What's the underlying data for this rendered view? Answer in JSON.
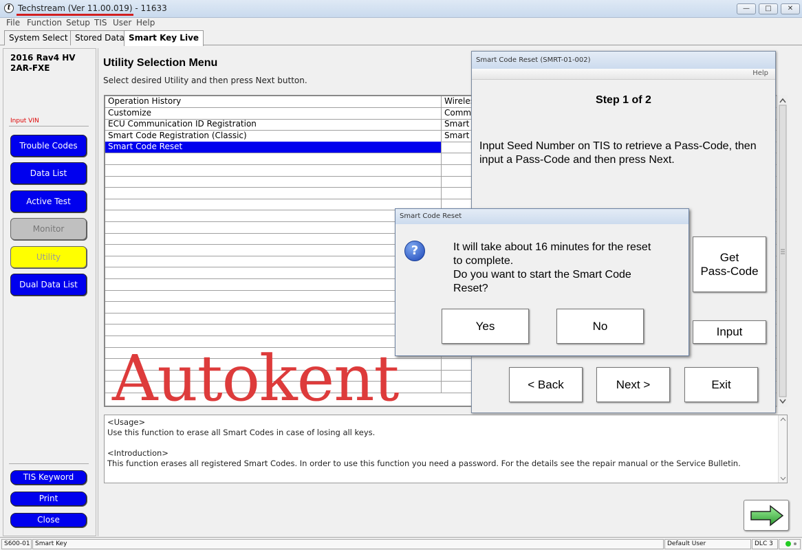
{
  "app": {
    "title": "Techstream (Ver 11.00.019) - 11633",
    "window_controls": {
      "minimize": "—",
      "maximize": "□",
      "close": "✕"
    }
  },
  "menu": [
    "File",
    "Function",
    "Setup",
    "TIS",
    "User",
    "Help"
  ],
  "tabs": [
    "System Select",
    "Stored Data",
    "Smart Key Live"
  ],
  "sidebar": {
    "vehicle": "2016 Rav4 HV\n2AR-FXE",
    "input_vin": "Input VIN",
    "buttons": [
      "Trouble Codes",
      "Data List",
      "Active Test",
      "Monitor",
      "Utility",
      "Dual Data List"
    ],
    "bottom_buttons": [
      "TIS Keyword",
      "Print",
      "Close"
    ]
  },
  "main": {
    "title": "Utility Selection Menu",
    "subtitle": "Select desired Utility and then press Next button.",
    "rows": [
      {
        "name": "Operation History",
        "desc": "Wireles"
      },
      {
        "name": "Customize",
        "desc": "Commu"
      },
      {
        "name": "ECU Communication ID Registration",
        "desc": "Smart C"
      },
      {
        "name": "Smart Code Registration (Classic)",
        "desc": "Smart C"
      },
      {
        "name": "Smart Code Reset",
        "desc": ""
      }
    ],
    "selected_row": 4,
    "watermark": "Autokent",
    "description": {
      "usage_head": "<Usage>",
      "usage": "Use this function to erase all Smart Codes in case of losing all keys.",
      "intro_head": "<Introduction>",
      "intro": "This function erases all registered Smart Codes. In order to use this function you need a password. For the details see the repair manual or the Service Bulletin."
    }
  },
  "smart_code_window": {
    "title": "Smart Code Reset (SMRT-01-002)",
    "help": "Help",
    "step": "Step 1 of 2",
    "instruction": "Input Seed Number on TIS to retrieve a Pass-Code, then input a Pass-Code and then press Next.",
    "get_passcode": "Get\nPass-Code",
    "input": "Input",
    "back": "< Back",
    "next": "Next >",
    "exit": "Exit"
  },
  "dialog": {
    "title": "Smart Code Reset",
    "icon": "?",
    "message": "It will take about 16 minutes for the reset\nto complete.\nDo you want to start the Smart Code\nReset?",
    "yes": "Yes",
    "no": "No"
  },
  "status": {
    "code": "S600-01",
    "system": "Smart Key",
    "user": "Default User",
    "connector": "DLC 3"
  },
  "colors": {
    "accent_blue": "#0000ee",
    "utility_yellow": "#ffff00",
    "watermark_red": "#dd3b3b",
    "status_green": "#22cc22"
  }
}
